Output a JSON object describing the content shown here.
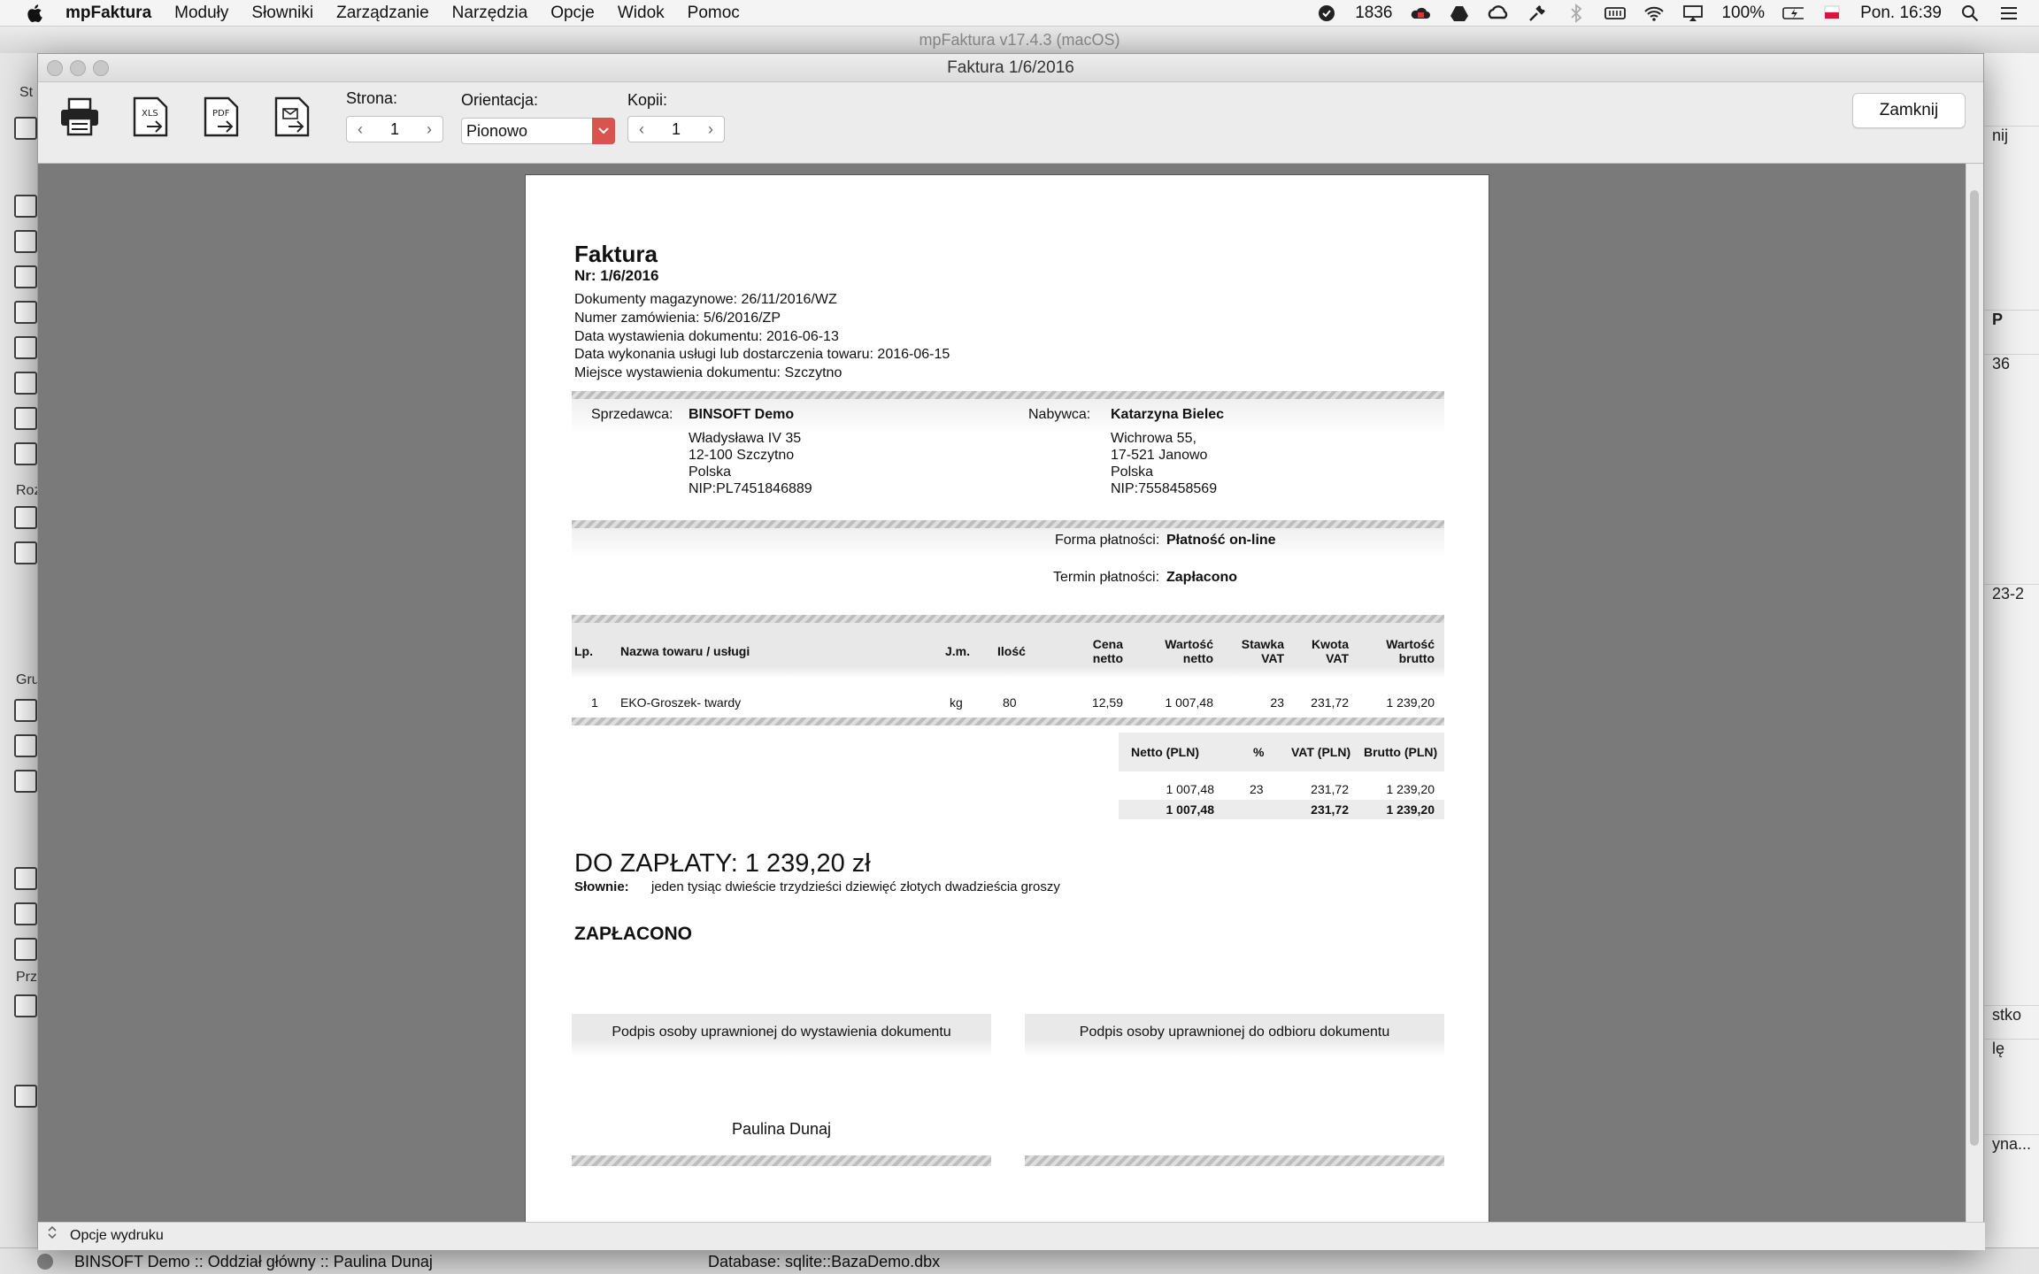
{
  "menubar": {
    "app_name": "mpFaktura",
    "items": [
      "Moduły",
      "Słowniki",
      "Zarządzanie",
      "Narzędzia",
      "Opcje",
      "Widok",
      "Pomoc"
    ],
    "status_count": "1836",
    "battery": "100%",
    "datetime": "Pon. 16:39"
  },
  "background_app": {
    "title": "mpFaktura v17.4.3 (macOS)",
    "sidebar_labels": [
      "St",
      "Roz",
      "Gru",
      "Prz"
    ],
    "right_cells": [
      "nij",
      "P",
      "36",
      "23-2",
      "stko",
      "lę",
      "yna..."
    ],
    "statusbar_left": "BINSOFT Demo :: Oddział główny :: Paulina Dunaj",
    "statusbar_db": "Database: sqlite::BazaDemo.dbx"
  },
  "preview": {
    "title": "Faktura 1/6/2016",
    "toolbar": {
      "page_label": "Strona:",
      "page_value": "1",
      "orientation_label": "Orientacja:",
      "orientation_value": "Pionowo",
      "copies_label": "Kopii:",
      "copies_value": "1",
      "close_label": "Zamknij",
      "icons": [
        "printer-icon",
        "xls-export-icon",
        "pdf-export-icon",
        "email-icon"
      ]
    },
    "bottom_label": "Opcje wydruku"
  },
  "invoice": {
    "title": "Faktura",
    "number": "Nr: 1/6/2016",
    "meta": [
      "Dokumenty magazynowe: 26/11/2016/WZ",
      "Numer zamówienia: 5/6/2016/ZP",
      "Data wystawienia dokumentu: 2016-06-13",
      "Data wykonania usługi lub dostarczenia towaru: 2016-06-15",
      "Miejsce wystawienia dokumentu: Szczytno"
    ],
    "seller": {
      "label": "Sprzedawca:",
      "name": "BINSOFT Demo",
      "lines": [
        "Władysława IV 35",
        "12-100 Szczytno",
        "Polska",
        "NIP:PL7451846889"
      ]
    },
    "buyer": {
      "label": "Nabywca:",
      "name": "Katarzyna Bielec",
      "lines": [
        "Wichrowa 55,",
        "17-521 Janowo",
        "Polska",
        "NIP:7558458569"
      ]
    },
    "payment": {
      "form_label": "Forma płatności:",
      "form_value": "Płatność on-line",
      "term_label": "Termin płatności:",
      "term_value": "Zapłacono"
    },
    "items_table": {
      "headers": {
        "lp": "Lp.",
        "name": "Nazwa towaru / usługi",
        "unit": "J.m.",
        "qty": "Ilość",
        "price_1": "Cena",
        "price_2": "netto",
        "net_1": "Wartość",
        "net_2": "netto",
        "rate_1": "Stawka",
        "rate_2": "VAT",
        "vat_1": "Kwota",
        "vat_2": "VAT",
        "gross_1": "Wartość",
        "gross_2": "brutto"
      },
      "rows": [
        {
          "lp": "1",
          "name": "EKO-Groszek- twardy",
          "unit": "kg",
          "qty": "80",
          "price": "12,59",
          "net": "1 007,48",
          "rate": "23",
          "vat": "231,72",
          "gross": "1 239,20"
        }
      ]
    },
    "summary_table": {
      "headers": {
        "net": "Netto (PLN)",
        "pct": "%",
        "vat": "VAT (PLN)",
        "gross": "Brutto (PLN)"
      },
      "row": {
        "net": "1 007,48",
        "pct": "23",
        "vat": "231,72",
        "gross": "1 239,20"
      },
      "total": {
        "net": "1 007,48",
        "vat": "231,72",
        "gross": "1 239,20"
      }
    },
    "due_text": "DO ZAPŁATY: 1 239,20 zł",
    "words_label": "Słownie:",
    "words_value": "jeden tysiąc dwieście trzydzieści dziewięć złotych dwadzieścia groszy",
    "paid_text": "ZAPŁACONO",
    "sig_issuer_label": "Podpis osoby uprawnionej do wystawienia dokumentu",
    "sig_receiver_label": "Podpis osoby uprawnionej do odbioru dokumentu",
    "issuer_name": "Paulina Dunaj"
  }
}
